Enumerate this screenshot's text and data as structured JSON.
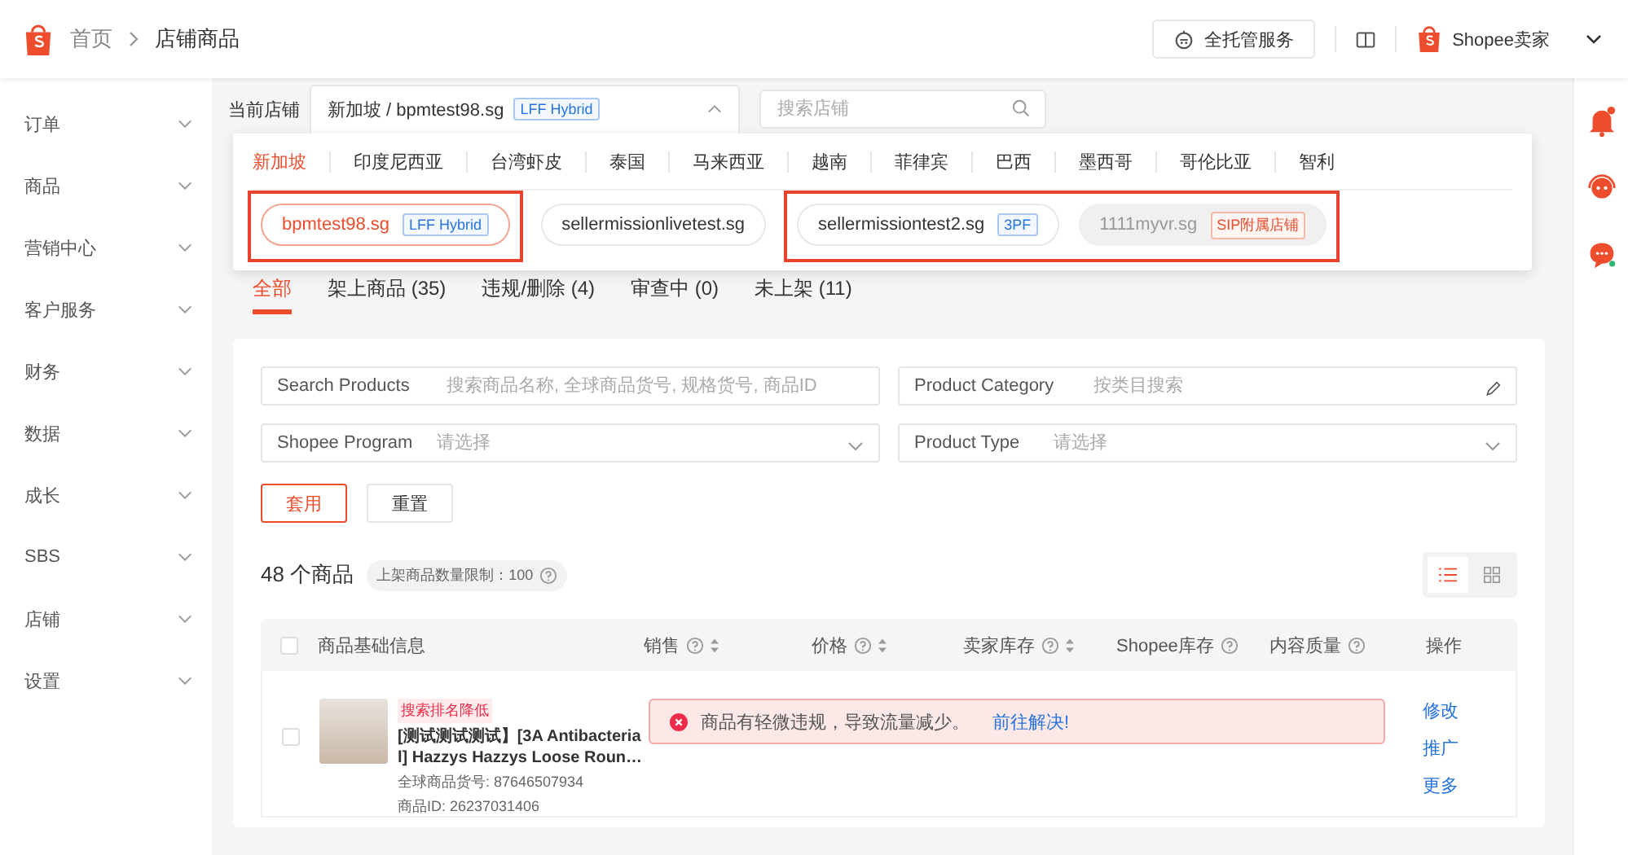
{
  "header": {
    "breadcrumb": [
      "首页",
      "店铺商品"
    ],
    "service_button": "全托管服务",
    "account": "Shopee卖家"
  },
  "sidebar": {
    "items": [
      {
        "label": "订单"
      },
      {
        "label": "商品"
      },
      {
        "label": "营销中心"
      },
      {
        "label": "客户服务"
      },
      {
        "label": "财务"
      },
      {
        "label": "数据"
      },
      {
        "label": "成长"
      },
      {
        "label": "SBS"
      },
      {
        "label": "店铺"
      },
      {
        "label": "设置"
      }
    ]
  },
  "store_selector": {
    "label": "当前店铺",
    "value": "新加坡 / bpmtest98.sg",
    "tag": "LFF Hybrid",
    "search_placeholder": "搜索店铺",
    "expanded": true
  },
  "dropdown": {
    "regions": [
      {
        "label": "新加坡",
        "selected": true
      },
      {
        "label": "印度尼西亚",
        "selected": false
      },
      {
        "label": "台湾虾皮",
        "selected": false
      },
      {
        "label": "泰国",
        "selected": false
      },
      {
        "label": "马来西亚",
        "selected": false
      },
      {
        "label": "越南",
        "selected": false
      },
      {
        "label": "菲律宾",
        "selected": false
      },
      {
        "label": "巴西",
        "selected": false
      },
      {
        "label": "墨西哥",
        "selected": false
      },
      {
        "label": "哥伦比亚",
        "selected": false
      },
      {
        "label": "智利",
        "selected": false
      }
    ],
    "store_groups": [
      {
        "highlighted": true,
        "stores": [
          {
            "name": "bpmtest98.sg",
            "tag": "LFF Hybrid",
            "kind": "program",
            "selected": true,
            "disabled": false
          }
        ]
      },
      {
        "highlighted": false,
        "stores": [
          {
            "name": "sellermissionlivetest.sg",
            "kind": "plain",
            "selected": false,
            "disabled": false
          }
        ]
      },
      {
        "highlighted": true,
        "stores": [
          {
            "name": "sellermissiontest2.sg",
            "tag": "3PF",
            "kind": "program",
            "selected": false,
            "disabled": false
          },
          {
            "name": "1111myvr.sg",
            "tag": "SIP附属店铺",
            "kind": "sip",
            "selected": false,
            "disabled": true
          }
        ]
      }
    ]
  },
  "tabs": [
    {
      "label": "全部",
      "selected": true
    },
    {
      "label": "架上商品 (35)",
      "selected": false
    },
    {
      "label": "违规/删除 (4)",
      "selected": false
    },
    {
      "label": "审查中 (0)",
      "selected": false
    },
    {
      "label": "未上架 (11)",
      "selected": false
    }
  ],
  "filters": [
    {
      "label": "Search Products",
      "placeholder": "搜索商品名称, 全球商品货号, 规格货号, 商品ID",
      "kind": "text"
    },
    {
      "label": "Product Category",
      "placeholder": "按类目搜索",
      "kind": "picker"
    },
    {
      "label": "Shopee Program",
      "placeholder": "请选择",
      "kind": "select"
    },
    {
      "label": "Product Type",
      "placeholder": "请选择",
      "kind": "select"
    }
  ],
  "buttons": [
    {
      "label": "套用",
      "kind": "primary"
    },
    {
      "label": "重置",
      "kind": "default"
    }
  ],
  "summary": {
    "count": "48 个商品",
    "limit": "上架商品数量限制：100"
  },
  "view_toggle": [
    {
      "kind": "list",
      "selected": true
    },
    {
      "kind": "grid",
      "selected": false
    }
  ],
  "table": {
    "select_all_checked": false,
    "columns": [
      {
        "label": "商品基础信息",
        "help": false,
        "sortable": false
      },
      {
        "label": "销售",
        "help": true,
        "sortable": true
      },
      {
        "label": "价格",
        "help": true,
        "sortable": true
      },
      {
        "label": "卖家库存",
        "help": true,
        "sortable": true
      },
      {
        "label": "Shopee库存",
        "help": true,
        "sortable": false
      },
      {
        "label": "内容质量",
        "help": true,
        "sortable": false
      },
      {
        "label": "操作",
        "help": false,
        "sortable": false
      }
    ],
    "rows": [
      {
        "checked": false,
        "tag": "搜索排名降低",
        "title": "[测试测试测试】[3A Antibacterial] Hazzys Hazzys Loose Roun…",
        "sku": "全球商品货号: 87646507934",
        "id": "商品ID: 26237031406",
        "alert": "商品有轻微违规，导致流量减少。",
        "alert_link": "前往解决!",
        "actions": [
          "修改",
          "推广",
          "更多"
        ]
      }
    ]
  }
}
